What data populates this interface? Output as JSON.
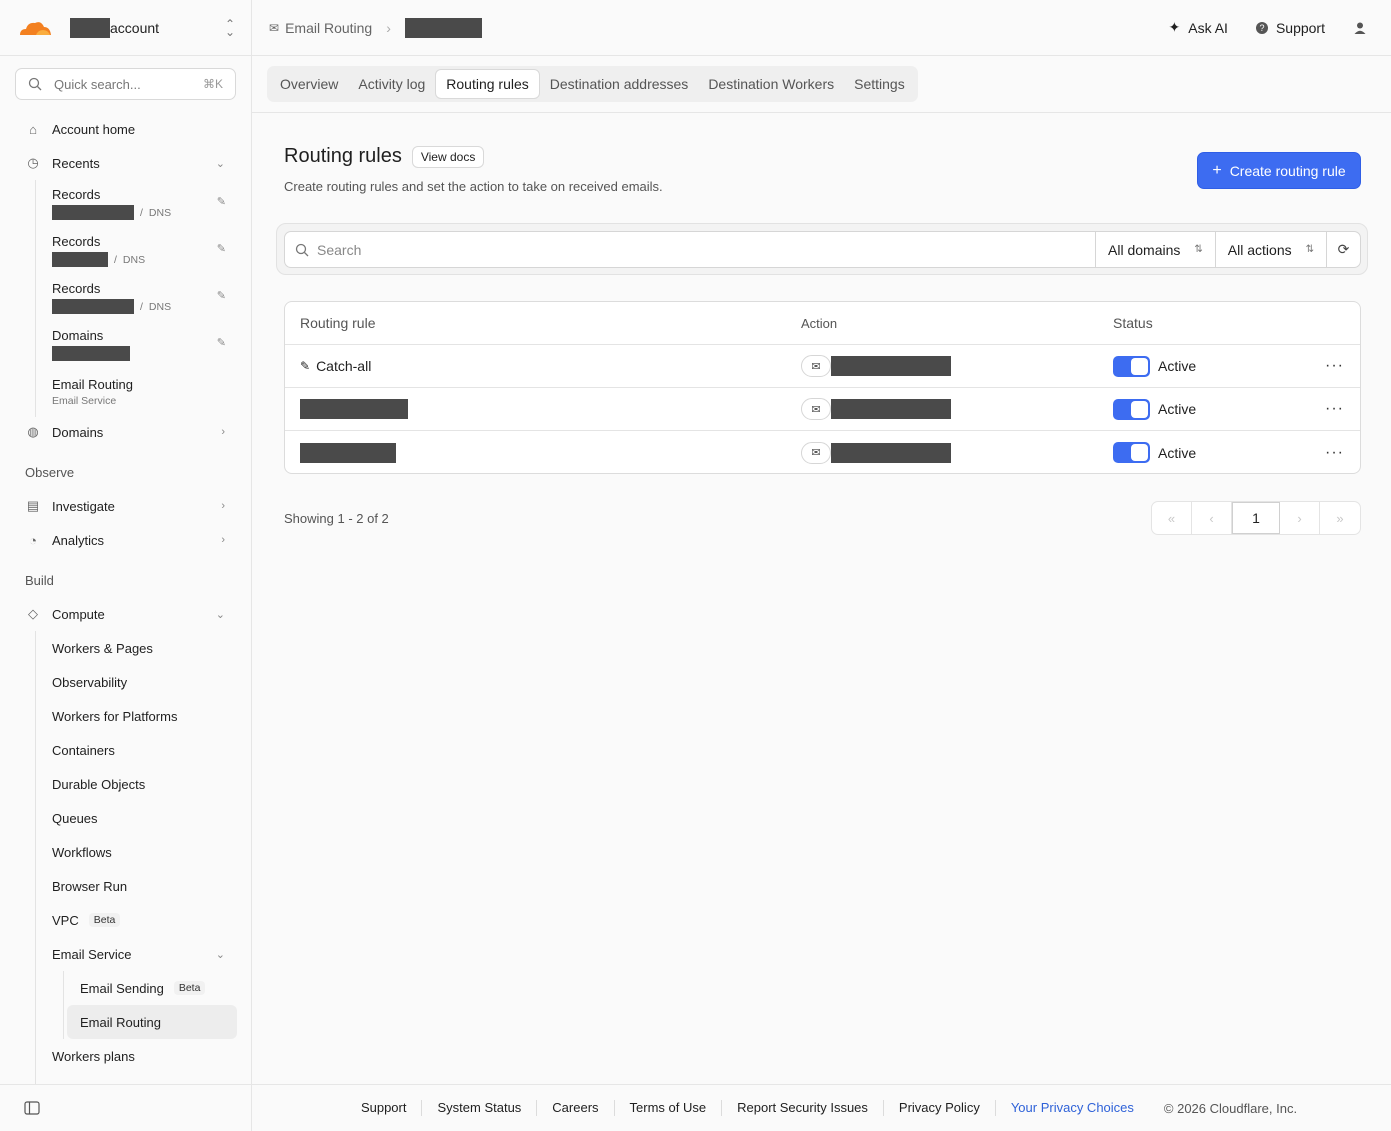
{
  "colors": {
    "accent": "#3d6cf1",
    "logo_orange": "#f38020",
    "link_blue": "#2f62d8"
  },
  "header": {
    "account_label": "account",
    "breadcrumb_section": "Email Routing",
    "ask_ai": "Ask AI",
    "support": "Support"
  },
  "sidebar": {
    "search_placeholder": "Quick search...",
    "search_shortcut": "⌘K",
    "account_home": "Account home",
    "recents": "Recents",
    "recent_items": [
      {
        "title": "Records",
        "detail": "DNS"
      },
      {
        "title": "Records",
        "detail": "DNS"
      },
      {
        "title": "Records",
        "detail": "DNS"
      },
      {
        "title": "Domains",
        "detail": ""
      },
      {
        "title": "Email Routing",
        "detail": "Email Service"
      }
    ],
    "domains": "Domains",
    "observe_label": "Observe",
    "investigate": "Investigate",
    "analytics": "Analytics",
    "build_label": "Build",
    "compute": "Compute",
    "compute_items": [
      "Workers & Pages",
      "Observability",
      "Workers for Platforms",
      "Containers",
      "Durable Objects",
      "Queues",
      "Workflows",
      "Browser Run"
    ],
    "vpc": "VPC",
    "beta": "Beta",
    "email_service": "Email Service",
    "email_sending": "Email Sending",
    "email_routing": "Email Routing",
    "workers_plans": "Workers plans"
  },
  "tabs": [
    "Overview",
    "Activity log",
    "Routing rules",
    "Destination addresses",
    "Destination Workers",
    "Settings"
  ],
  "page": {
    "title": "Routing rules",
    "view_docs": "View docs",
    "subtitle": "Create routing rules and set the action to take on received emails.",
    "create_button": "Create routing rule",
    "search_placeholder": "Search",
    "filter_domains": "All domains",
    "filter_actions": "All actions"
  },
  "table": {
    "headers": [
      "Routing rule",
      "Action",
      "Status"
    ],
    "rows": [
      {
        "rule": "Catch-all",
        "status": "Active"
      },
      {
        "rule": "",
        "status": "Active"
      },
      {
        "rule": "",
        "status": "Active"
      }
    ]
  },
  "pagination": {
    "showing": "Showing 1 - 2 of 2",
    "current_page": "1"
  },
  "footer": {
    "links": [
      "Support",
      "System Status",
      "Careers",
      "Terms of Use",
      "Report Security Issues",
      "Privacy Policy"
    ],
    "privacy_choices": "Your Privacy Choices",
    "copyright": "© 2026 Cloudflare, Inc."
  }
}
